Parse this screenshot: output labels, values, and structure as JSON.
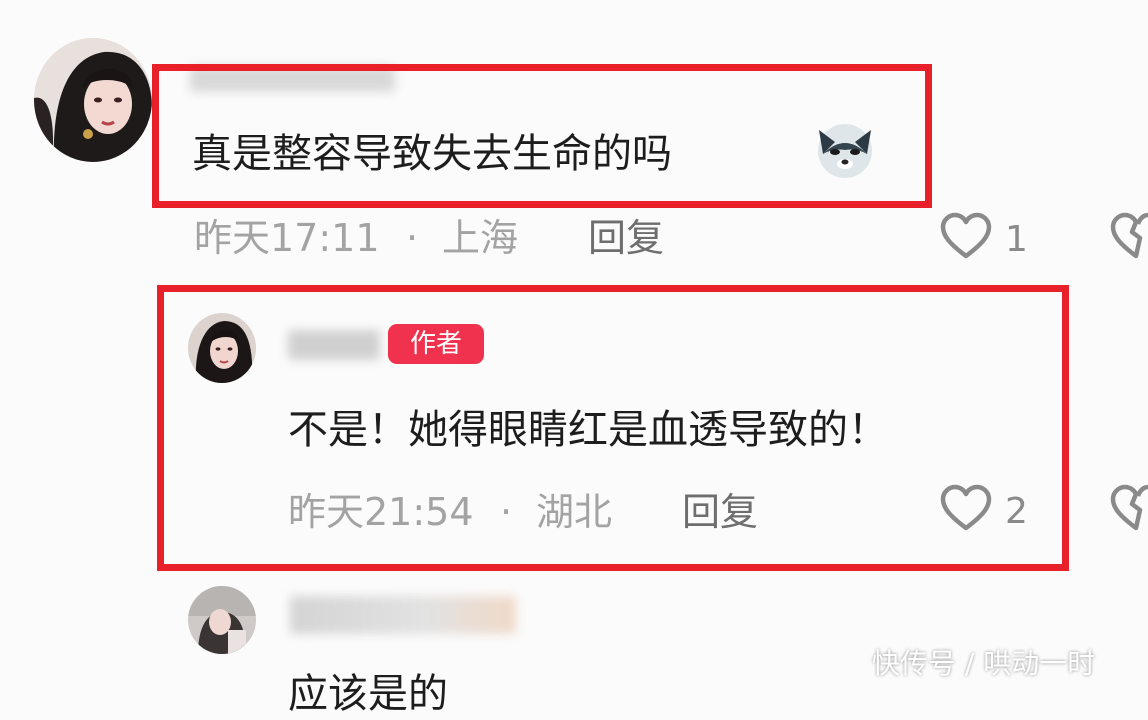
{
  "comment": {
    "text": "真是整容导致失去生命的吗",
    "emoji_icon": "wolf-emoji-icon",
    "time": "昨天17:11",
    "separator": "·",
    "location": "上海",
    "reply_label": "回复",
    "likes": "1"
  },
  "reply": {
    "author_badge": "作者",
    "text": "不是！她得眼睛红是血透导致的！",
    "time": "昨天21:54",
    "separator": "·",
    "location": "湖北",
    "reply_label": "回复",
    "likes": "2"
  },
  "next_comment": {
    "text": "应该是的"
  },
  "watermark": "快传号 / 哄动一时",
  "colors": {
    "highlight_box": "#e8202a",
    "author_badge": "#f0324e",
    "meta_text": "#a3a3a3"
  }
}
